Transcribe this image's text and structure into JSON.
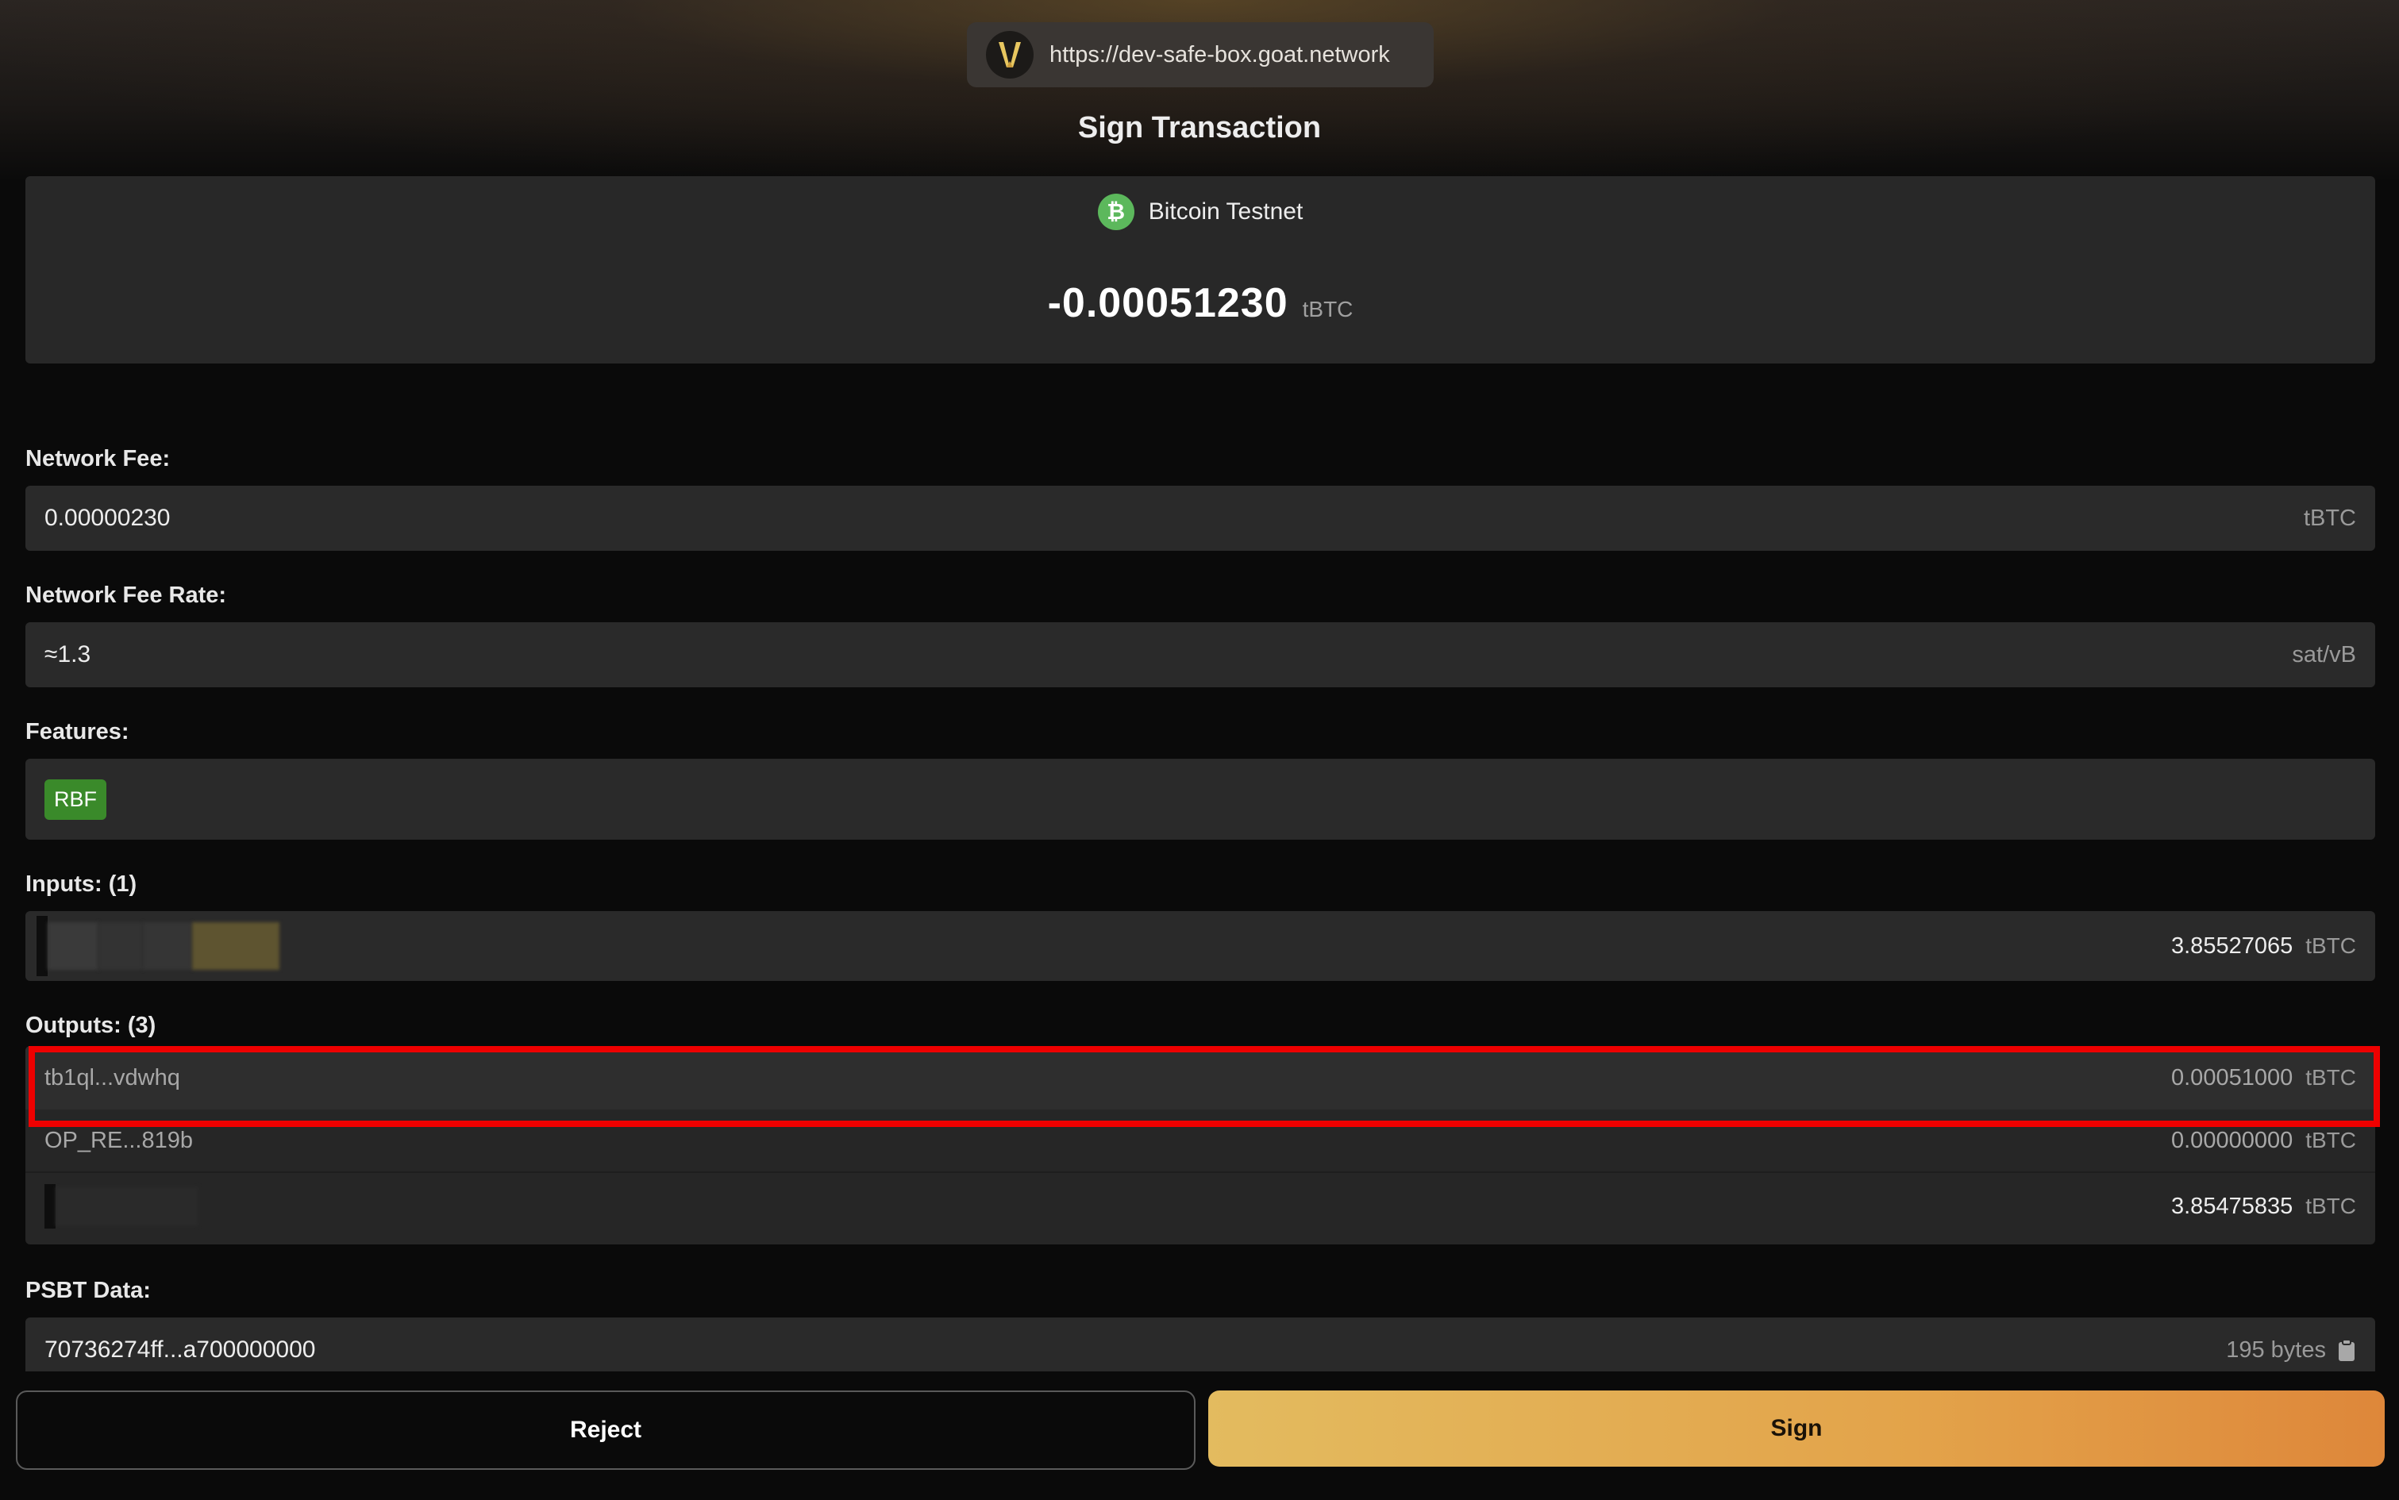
{
  "origin": {
    "url": "https://dev-safe-box.goat.network",
    "logo_icon": "goat-logo-icon"
  },
  "title": "Sign Transaction",
  "summary": {
    "network_name": "Bitcoin Testnet",
    "network_icon": "bitcoin-icon",
    "amount": "-0.00051230",
    "unit": "tBTC"
  },
  "network_fee": {
    "label": "Network Fee:",
    "value": "0.00000230",
    "unit": "tBTC"
  },
  "fee_rate": {
    "label": "Network Fee Rate:",
    "value": "≈1.3",
    "unit": "sat/vB"
  },
  "features": {
    "label": "Features:",
    "badges": [
      "RBF"
    ]
  },
  "inputs": {
    "label": "Inputs: (1)",
    "items": [
      {
        "address": "",
        "amount": "3.85527065",
        "unit": "tBTC"
      }
    ]
  },
  "outputs": {
    "label": "Outputs: (3)",
    "items": [
      {
        "address": "tb1ql...vdwhq",
        "amount": "0.00051000",
        "unit": "tBTC"
      },
      {
        "address": "OP_RE...819b",
        "amount": "0.00000000",
        "unit": "tBTC"
      },
      {
        "address": "",
        "amount": "3.85475835",
        "unit": "tBTC"
      }
    ]
  },
  "psbt": {
    "label": "PSBT Data:",
    "value": "70736274ff...a700000000",
    "size": "195 bytes",
    "copy_icon": "clipboard-icon"
  },
  "actions": {
    "reject_label": "Reject",
    "sign_label": "Sign"
  },
  "colors": {
    "accent_start": "#e3bb5f",
    "accent_end": "#de873a",
    "highlight": "#ee0000",
    "rbf_badge": "#3a8a2a",
    "bitcoin_green": "#5cb85c"
  }
}
